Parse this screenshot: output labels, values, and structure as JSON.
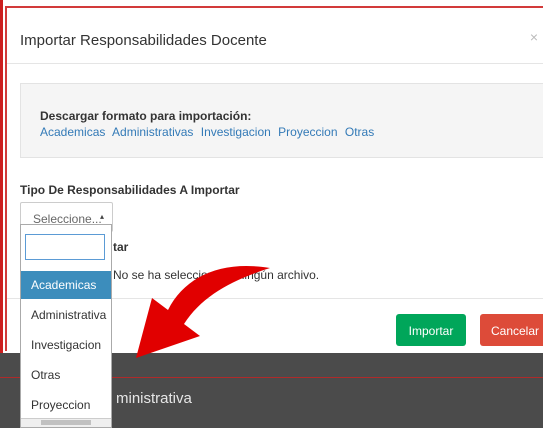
{
  "modal": {
    "title": "Importar Responsabilidades Docente",
    "close_symbol": "×",
    "download_section": {
      "title": "Descargar formato para importación:",
      "links": [
        "Academicas",
        "Administrativas",
        "Investigacion",
        "Proyeccion",
        "Otras"
      ]
    },
    "type_label": "Tipo De Responsabilidades A Importar",
    "select": {
      "placeholder": "Seleccione...",
      "arrow": "▴"
    },
    "file_label": "tar",
    "file_status": "No se ha seleccionado ningún archivo.",
    "buttons": {
      "import": "Importar",
      "cancel": "Cancelar"
    }
  },
  "dropdown": {
    "search_value": "",
    "items": [
      "Academicas",
      "Administrativa",
      "Investigacion",
      "Otras",
      "Proyeccion"
    ],
    "active_index": 0
  },
  "background": {
    "partial_text": "ministrativa"
  },
  "colors": {
    "link": "#337ab7",
    "import_button": "#00a65a",
    "cancel_button": "#dd4b39",
    "active_item": "#3c8dbc",
    "arrow": "#e10000"
  },
  "icons": {
    "close": "close-icon",
    "select_arrow": "caret-up-icon",
    "annotation": "red-arrow-icon"
  }
}
